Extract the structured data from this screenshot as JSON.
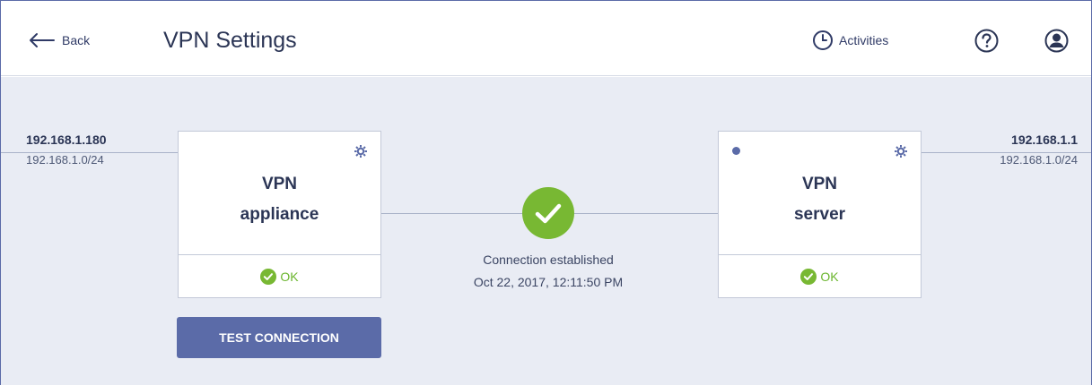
{
  "header": {
    "back_label": "Back",
    "title": "VPN Settings",
    "activities_label": "Activities"
  },
  "left_network": {
    "ip": "192.168.1.180",
    "subnet": "192.168.1.0/24"
  },
  "right_network": {
    "ip": "192.168.1.1",
    "subnet": "192.168.1.0/24"
  },
  "appliance": {
    "name_line1": "VPN",
    "name_line2": "appliance",
    "status": "OK"
  },
  "server": {
    "name_line1": "VPN",
    "name_line2": "server",
    "status": "OK"
  },
  "connection": {
    "status_text": "Connection established",
    "timestamp": "Oct 22, 2017, 12:11:50 PM"
  },
  "actions": {
    "test_connection_label": "TEST CONNECTION"
  },
  "colors": {
    "accent": "#5b6ba8",
    "ok_green": "#78b833",
    "background": "#e9ecf4",
    "header_text": "#2b3555"
  },
  "icons": {
    "back": "arrow-left-icon",
    "activities": "clock-icon",
    "help": "question-circle-icon",
    "user": "user-circle-icon",
    "settings": "gear-icon",
    "status_ok": "check-circle-icon",
    "connection": "check-circle-icon"
  }
}
